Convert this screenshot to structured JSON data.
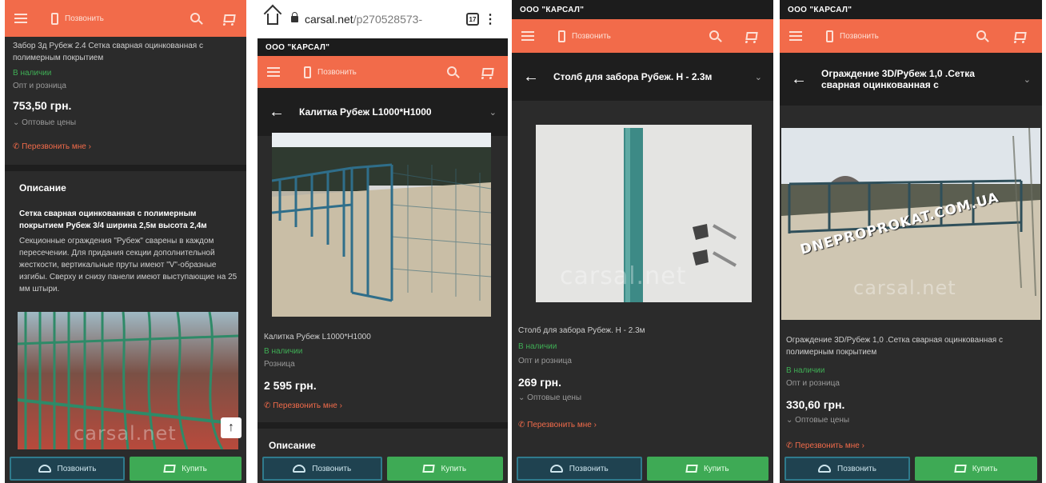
{
  "common": {
    "company": "ООО \"КАРСАЛ\"",
    "call_label": "Позвонить",
    "buy_label": "Купить",
    "callback_label": "Перезвонить мне",
    "watermark": "carsal.net",
    "description_heading": "Описание"
  },
  "browser": {
    "domain": "carsal.net",
    "path": "/p270528573-",
    "tab_count": "17"
  },
  "screen1": {
    "product_title": "Забор 3д Рубеж 2.4 Сетка сварная оцинкованная с полимерным покрытием",
    "availability": "В наличии",
    "sale_type": "Опт и розница",
    "price": "753,50 грн.",
    "wholesale": "Оптовые цены",
    "description_bold": "Сетка сварная оцинкованная с полимерным покрытием Рубеж 3/4 ширина 2,5м высота 2,4м",
    "description_text": "Секционные ограждения \"Рубеж\" сварены в каждом пересечении. Для придания секции дополнительной жесткости, вертикальные пруты имеют \"V\"-образные изгибы. Сверху и снизу панели имеют выступающие на 25 мм штыри."
  },
  "screen2": {
    "header_title": "Калитка Рубеж L1000*H1000",
    "product_title": "Калитка Рубеж L1000*H1000",
    "availability": "В наличии",
    "sale_type": "Розница",
    "price": "2 595 грн."
  },
  "screen3": {
    "header_title": "Столб для забора Рубеж. H - 2.3м",
    "product_title": "Столб для забора Рубеж. H - 2.3м",
    "availability": "В наличии",
    "sale_type": "Опт и розница",
    "price": "269 грн.",
    "wholesale": "Оптовые цены"
  },
  "screen4": {
    "header_title": "Ограждение 3D/Рубеж 1,0 .Сетка сварная оцинкованная с",
    "photo_watermark": "DNEPROPROKAT.COM.UA",
    "product_title": "Ограждение 3D/Рубеж 1,0 .Сетка сварная оцинкованная с полимерным покрытием",
    "availability": "В наличии",
    "sale_type": "Опт и розница",
    "price": "330,60 грн.",
    "wholesale": "Оптовые цены"
  }
}
